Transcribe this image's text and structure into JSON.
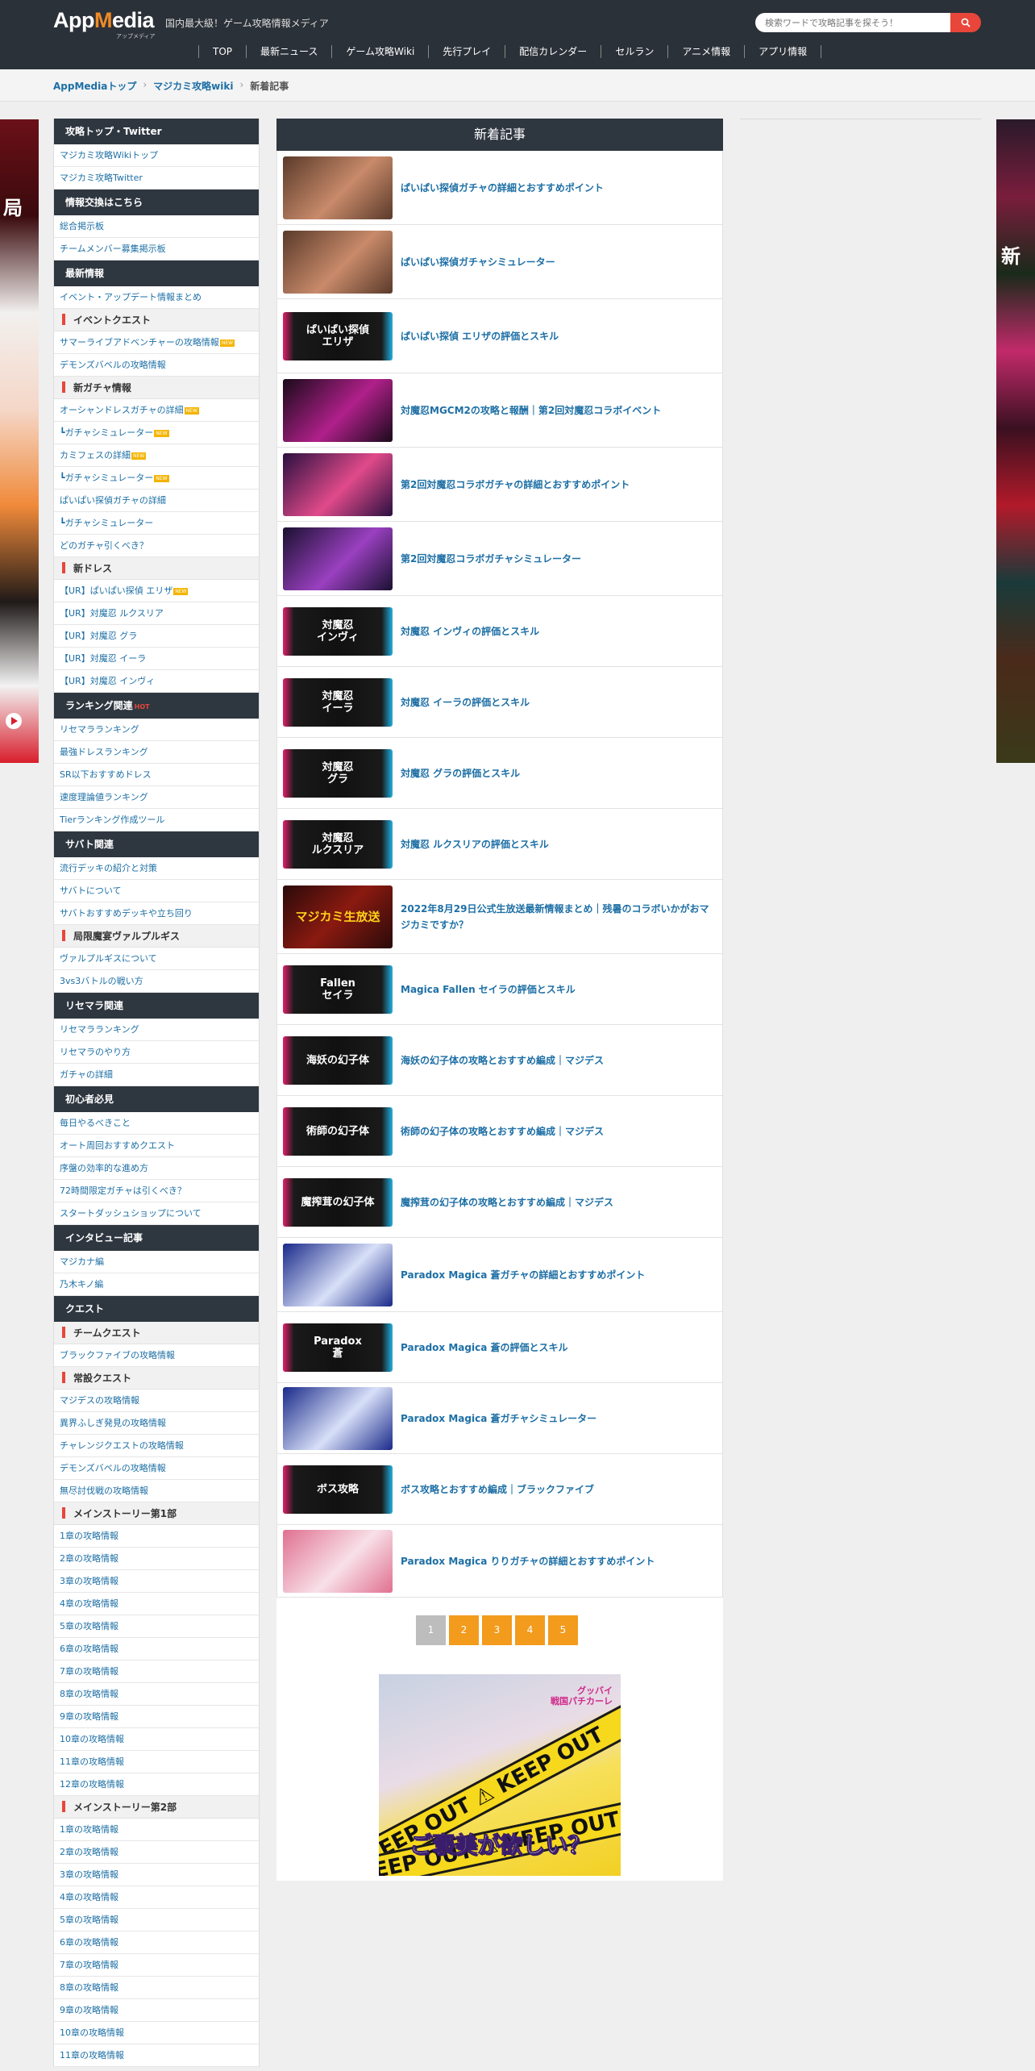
{
  "header": {
    "logo_main": "App",
    "logo_accent": "M",
    "logo_rest": "edia",
    "logo_sub": "アップメディア",
    "tagline": "国内最大級！ゲーム攻略情報メディア",
    "search_placeholder": "検索ワードで攻略記事を探そう！",
    "nav": [
      "TOP",
      "最新ニュース",
      "ゲーム攻略Wiki",
      "先行プレイ",
      "配信カレンダー",
      "セルラン",
      "アニメ情報",
      "アプリ情報"
    ]
  },
  "breadcrumb": {
    "items": [
      "AppMediaトップ",
      "マジカミ攻略wiki"
    ],
    "current": "新着記事"
  },
  "side_banners": {
    "left_text": "局",
    "right_text": "新"
  },
  "sidebar": [
    {
      "type": "header",
      "label": "攻略トップ・Twitter"
    },
    {
      "type": "item",
      "label": "マジカミ攻略Wikiトップ"
    },
    {
      "type": "item",
      "label": "マジカミ攻略Twitter"
    },
    {
      "type": "header",
      "label": "情報交換はこちら"
    },
    {
      "type": "item",
      "label": "総合掲示板"
    },
    {
      "type": "item",
      "label": "チームメンバー募集掲示板"
    },
    {
      "type": "header",
      "label": "最新情報"
    },
    {
      "type": "item",
      "label": "イベント・アップデート情報まとめ"
    },
    {
      "type": "sub",
      "label": "イベントクエスト"
    },
    {
      "type": "item",
      "label": "サマーライブアドベンチャーの攻略情報",
      "tag": "NEW"
    },
    {
      "type": "item",
      "label": "デモンズバベルの攻略情報"
    },
    {
      "type": "sub",
      "label": "新ガチャ情報"
    },
    {
      "type": "item",
      "label": "オーシャンドレスガチャの詳細",
      "tag": "NEW"
    },
    {
      "type": "item",
      "label": "┗ガチャシミュレーター",
      "tag": "NEW"
    },
    {
      "type": "item",
      "label": "カミフェスの詳細",
      "tag": "NEW"
    },
    {
      "type": "item",
      "label": "┗ガチャシミュレーター",
      "tag": "NEW"
    },
    {
      "type": "item",
      "label": "ぱいぱい探偵ガチャの詳細"
    },
    {
      "type": "item",
      "label": "┗ガチャシミュレーター"
    },
    {
      "type": "item",
      "label": "どのガチャ引くべき？"
    },
    {
      "type": "sub",
      "label": "新ドレス"
    },
    {
      "type": "item",
      "label": "【UR】ぱいぱい探偵 エリザ",
      "tag": "NEW"
    },
    {
      "type": "item",
      "label": "【UR】対魔忍 ルクスリア"
    },
    {
      "type": "item",
      "label": "【UR】対魔忍 グラ"
    },
    {
      "type": "item",
      "label": "【UR】対魔忍 イーラ"
    },
    {
      "type": "item",
      "label": "【UR】対魔忍 インヴィ"
    },
    {
      "type": "header",
      "label": "ランキング関連",
      "hot": "HOT"
    },
    {
      "type": "item",
      "label": "リセマラランキング"
    },
    {
      "type": "item",
      "label": "最強ドレスランキング"
    },
    {
      "type": "item",
      "label": "SR以下おすすめドレス"
    },
    {
      "type": "item",
      "label": "速度理論値ランキング"
    },
    {
      "type": "item",
      "label": "Tierランキング作成ツール"
    },
    {
      "type": "header",
      "label": "サバト関連"
    },
    {
      "type": "item",
      "label": "流行デッキの紹介と対策"
    },
    {
      "type": "item",
      "label": "サバトについて"
    },
    {
      "type": "item",
      "label": "サバトおすすめデッキや立ち回り"
    },
    {
      "type": "sub",
      "label": "局限魔宴ヴァルプルギス"
    },
    {
      "type": "item",
      "label": "ヴァルプルギスについて"
    },
    {
      "type": "item",
      "label": "3vs3バトルの戦い方"
    },
    {
      "type": "header",
      "label": "リセマラ関連"
    },
    {
      "type": "item",
      "label": "リセマラランキング"
    },
    {
      "type": "item",
      "label": "リセマラのやり方"
    },
    {
      "type": "item",
      "label": "ガチャの詳細"
    },
    {
      "type": "header",
      "label": "初心者必見"
    },
    {
      "type": "item",
      "label": "毎日やるべきこと"
    },
    {
      "type": "item",
      "label": "オート周回おすすめクエスト"
    },
    {
      "type": "item",
      "label": "序盤の効率的な進め方"
    },
    {
      "type": "item",
      "label": "72時間限定ガチャは引くべき？"
    },
    {
      "type": "item",
      "label": "スタートダッシュショップについて"
    },
    {
      "type": "header",
      "label": "インタビュー記事"
    },
    {
      "type": "item",
      "label": "マジカナ編"
    },
    {
      "type": "item",
      "label": "乃木キノ編"
    },
    {
      "type": "header",
      "label": "クエスト"
    },
    {
      "type": "sub",
      "label": "チームクエスト"
    },
    {
      "type": "item",
      "label": "ブラックファイブの攻略情報"
    },
    {
      "type": "sub",
      "label": "常設クエスト"
    },
    {
      "type": "item",
      "label": "マジデスの攻略情報"
    },
    {
      "type": "item",
      "label": "異界ふしぎ発見の攻略情報"
    },
    {
      "type": "item",
      "label": "チャレンジクエストの攻略情報"
    },
    {
      "type": "item",
      "label": "デモンズバベルの攻略情報"
    },
    {
      "type": "item",
      "label": "無尽討伐戦の攻略情報"
    },
    {
      "type": "sub",
      "label": "メインストーリー第1部"
    },
    {
      "type": "item",
      "label": "1章の攻略情報"
    },
    {
      "type": "item",
      "label": "2章の攻略情報"
    },
    {
      "type": "item",
      "label": "3章の攻略情報"
    },
    {
      "type": "item",
      "label": "4章の攻略情報"
    },
    {
      "type": "item",
      "label": "5章の攻略情報"
    },
    {
      "type": "item",
      "label": "6章の攻略情報"
    },
    {
      "type": "item",
      "label": "7章の攻略情報"
    },
    {
      "type": "item",
      "label": "8章の攻略情報"
    },
    {
      "type": "item",
      "label": "9章の攻略情報"
    },
    {
      "type": "item",
      "label": "10章の攻略情報"
    },
    {
      "type": "item",
      "label": "11章の攻略情報"
    },
    {
      "type": "item",
      "label": "12章の攻略情報"
    },
    {
      "type": "sub",
      "label": "メインストーリー第2部"
    },
    {
      "type": "item",
      "label": "1章の攻略情報"
    },
    {
      "type": "item",
      "label": "2章の攻略情報"
    },
    {
      "type": "item",
      "label": "3章の攻略情報"
    },
    {
      "type": "item",
      "label": "4章の攻略情報"
    },
    {
      "type": "item",
      "label": "5章の攻略情報"
    },
    {
      "type": "item",
      "label": "6章の攻略情報"
    },
    {
      "type": "item",
      "label": "7章の攻略情報"
    },
    {
      "type": "item",
      "label": "8章の攻略情報"
    },
    {
      "type": "item",
      "label": "9章の攻略情報"
    },
    {
      "type": "item",
      "label": "10章の攻略情報"
    },
    {
      "type": "item",
      "label": "11章の攻略情報"
    }
  ],
  "main": {
    "heading": "新着記事",
    "articles": [
      {
        "title": "ぱいぱい探偵ガチャの詳細とおすすめポイント",
        "thumb_style": "art",
        "thumb_colors": [
          "#5a3a2a",
          "#c88a6a"
        ]
      },
      {
        "title": "ぱいぱい探偵ガチャシミュレーター",
        "thumb_style": "art",
        "thumb_colors": [
          "#5a3a2a",
          "#c88a6a"
        ]
      },
      {
        "title": "ぱいぱい探偵 エリザの評価とスキル",
        "thumb_style": "label",
        "thumb_text": "ぱいぱい探偵\nエリザ"
      },
      {
        "title": "対魔忍MGCM2の攻略と報酬｜第2回対魔忍コラボイベント",
        "thumb_style": "art",
        "thumb_colors": [
          "#1a0a1a",
          "#b0208a"
        ]
      },
      {
        "title": "第2回対魔忍コラボガチャの詳細とおすすめポイント",
        "thumb_style": "art",
        "thumb_colors": [
          "#2a1040",
          "#e04a8a"
        ]
      },
      {
        "title": "第2回対魔忍コラボガチャシミュレーター",
        "thumb_style": "art",
        "thumb_colors": [
          "#1a1030",
          "#9a40c0"
        ]
      },
      {
        "title": "対魔忍 インヴィの評価とスキル",
        "thumb_style": "label",
        "thumb_text": "対魔忍\nインヴィ"
      },
      {
        "title": "対魔忍 イーラの評価とスキル",
        "thumb_style": "label",
        "thumb_text": "対魔忍\nイーラ"
      },
      {
        "title": "対魔忍 グラの評価とスキル",
        "thumb_style": "label",
        "thumb_text": "対魔忍\nグラ"
      },
      {
        "title": "対魔忍 ルクスリアの評価とスキル",
        "thumb_style": "label",
        "thumb_text": "対魔忍\nルクスリア"
      },
      {
        "title": "2022年8月29日公式生放送最新情報まとめ｜残暑のコラボいかがおマジカミですか？",
        "thumb_style": "label-red",
        "thumb_text": "マジカミ生放送"
      },
      {
        "title": "Magica Fallen セイラの評価とスキル",
        "thumb_style": "label",
        "thumb_text": "Fallen\nセイラ"
      },
      {
        "title": "海妖の幻子体の攻略とおすすめ編成｜マジデス",
        "thumb_style": "label",
        "thumb_text": "海妖の幻子体"
      },
      {
        "title": "術師の幻子体の攻略とおすすめ編成｜マジデス",
        "thumb_style": "label",
        "thumb_text": "術師の幻子体"
      },
      {
        "title": "魔搾茸の幻子体の攻略とおすすめ編成｜マジデス",
        "thumb_style": "label",
        "thumb_text": "魔搾茸の幻子体"
      },
      {
        "title": "Paradox Magica 蒼ガチャの詳細とおすすめポイント",
        "thumb_style": "art",
        "thumb_colors": [
          "#1a2a8a",
          "#d8e0f8"
        ]
      },
      {
        "title": "Paradox Magica 蒼の評価とスキル",
        "thumb_style": "label",
        "thumb_text": "Paradox\n蒼"
      },
      {
        "title": "Paradox Magica 蒼ガチャシミュレーター",
        "thumb_style": "art",
        "thumb_colors": [
          "#1a2a8a",
          "#d8e0f8"
        ]
      },
      {
        "title": "ボス攻略とおすすめ編成｜ブラックファイブ",
        "thumb_style": "label",
        "thumb_text": "ボス攻略"
      },
      {
        "title": "Paradox Magica りりガチャの詳細とおすすめポイント",
        "thumb_style": "art",
        "thumb_colors": [
          "#e07090",
          "#f8e0e8"
        ]
      }
    ],
    "pagination": [
      "1",
      "2",
      "3",
      "4",
      "5"
    ],
    "current_page": "1"
  },
  "ad": {
    "tape_text": "KEEP OUT ⚠ KEEP OUT",
    "caption": "ご褒美が欲しい？",
    "logo": "グッバイ\n戦国パチカーレ"
  },
  "colors": {
    "header_bg": "#2b3138",
    "accent": "#f08a24",
    "search_button": "#e8463a",
    "link": "#1d6fa5",
    "pager": "#f29b1d"
  }
}
